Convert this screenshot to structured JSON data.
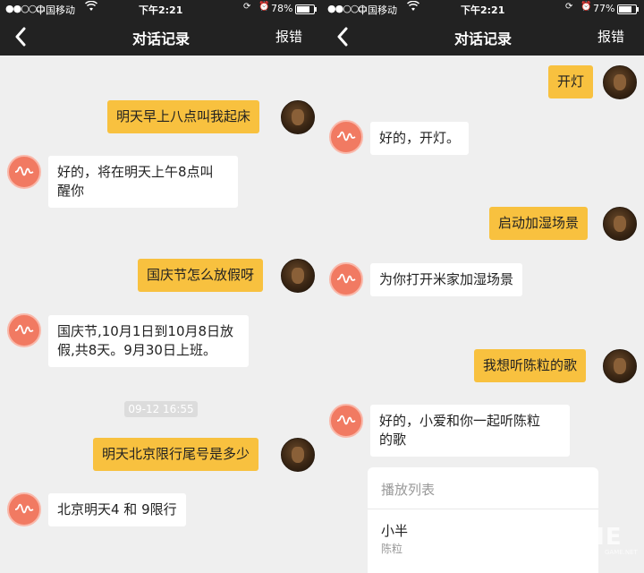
{
  "colors": {
    "header_bg": "#222222",
    "chat_bg": "#efefef",
    "user_bubble": "#f8c13f",
    "bot_bubble": "#ffffff",
    "bot_icon": "#f17a62"
  },
  "left": {
    "status": {
      "signal": "●●○○○",
      "carrier": "中国移动",
      "time": "下午2:21",
      "battery_text": "78%",
      "battery_level": 0.78
    },
    "nav": {
      "title": "对话记录",
      "report": "报错"
    },
    "messages": [
      {
        "from": "user",
        "text": "明天早上八点叫我起床"
      },
      {
        "from": "bot",
        "text": "好的，将在明天上午8点叫\n醒你"
      },
      {
        "from": "user",
        "text": "国庆节怎么放假呀"
      },
      {
        "from": "bot",
        "text": "国庆节,10月1日到10月8日放\n假,共8天。9月30日上班。"
      },
      {
        "from": "user",
        "text": "明天北京限行尾号是多少"
      },
      {
        "from": "bot",
        "text": "北京明天4 和 9限行"
      }
    ],
    "timestamp": "09-12 16:55"
  },
  "right": {
    "status": {
      "signal": "●●○○○",
      "carrier": "中国移动",
      "time": "下午2:21",
      "battery_text": "77%",
      "battery_level": 0.77
    },
    "nav": {
      "title": "对话记录",
      "report": "报错"
    },
    "messages": [
      {
        "from": "user",
        "text": "开灯"
      },
      {
        "from": "bot",
        "text": "好的，开灯。"
      },
      {
        "from": "user",
        "text": "启动加湿场景"
      },
      {
        "from": "bot",
        "text": "为你打开米家加湿场景"
      },
      {
        "from": "user",
        "text": "我想听陈粒的歌"
      },
      {
        "from": "bot",
        "text": "好的，小爱和你一起听陈粒\n的歌"
      }
    ],
    "playlist": {
      "title": "播放列表",
      "songs": [
        {
          "name": "小半",
          "artist": "陈粒"
        }
      ]
    }
  },
  "watermark": {
    "text": "ME",
    "sub": "GAME.NET"
  }
}
